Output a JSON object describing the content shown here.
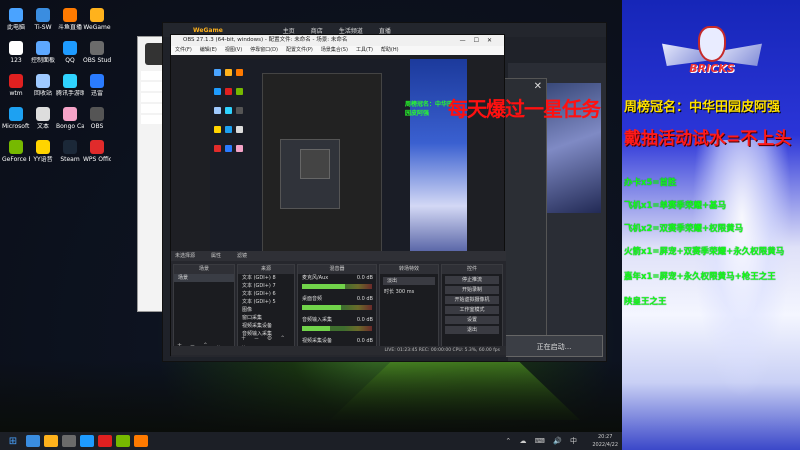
{
  "desktop": {
    "icons": [
      {
        "label": "此电脑",
        "color": "#4aa3ff"
      },
      {
        "label": "Ti-SW",
        "color": "#3a8de0"
      },
      {
        "label": "斗鱼直播",
        "color": "#ff7a00"
      },
      {
        "label": "WeGame",
        "color": "#ffb21c"
      },
      {
        "label": "123",
        "color": "#ffffff"
      },
      {
        "label": "控制面板",
        "color": "#5da8ff"
      },
      {
        "label": "QQ",
        "color": "#1e9bff"
      },
      {
        "label": "OBS Studio",
        "color": "#6b6b6b"
      },
      {
        "label": "wtm",
        "color": "#e02020"
      },
      {
        "label": "回收站",
        "color": "#9ec9ff"
      },
      {
        "label": "腾讯手游助手",
        "color": "#2fd3ff"
      },
      {
        "label": "迅雷",
        "color": "#2a7bff"
      },
      {
        "label": "Microsoft Edge",
        "color": "#1da1f2"
      },
      {
        "label": "文本",
        "color": "#dddddd"
      },
      {
        "label": "Bongo Cat",
        "color": "#f5a3c7"
      },
      {
        "label": "OBS",
        "color": "#555555"
      },
      {
        "label": "GeForce Experience",
        "color": "#76b900"
      },
      {
        "label": "YY语音",
        "color": "#ffd400"
      },
      {
        "label": "Steam",
        "color": "#1b2838"
      },
      {
        "label": "WPS Office",
        "color": "#e02b2b"
      }
    ]
  },
  "taskbar": {
    "start": "⊞",
    "items": [
      "#3a8de0",
      "#ffb21c",
      "#6b6b6b",
      "#1e9bff",
      "#e02020",
      "#76b900",
      "#ff7a00"
    ],
    "tray_icons": "⌃ ☁ ⌨ 🔊 中",
    "time": "20:27",
    "date": "2022/4/22"
  },
  "wegame": {
    "logo": "WeGame",
    "tabs": [
      "主页",
      "商店",
      "生活频道",
      "直播"
    ]
  },
  "obs": {
    "title": "OBS 27.1.3 (64-bit, windows) - 配置文件: 未命名 - 场景: 未命名",
    "menu": [
      "文件(F)",
      "编辑(E)",
      "视图(V)",
      "停靠窗口(D)",
      "配置文件(P)",
      "场景集合(S)",
      "工具(T)",
      "帮助(H)"
    ],
    "dock_tabs": [
      "未选择源",
      "属性",
      "滤镜"
    ],
    "scenes": {
      "header": "场景",
      "items": [
        "场景"
      ]
    },
    "sources": {
      "header": "来源",
      "items": [
        "文本 (GDI+) 8",
        "文本 (GDI+) 7",
        "文本 (GDI+) 6",
        "文本 (GDI+) 5",
        "图像",
        "窗口采集",
        "视频采集设备",
        "音频输入采集"
      ]
    },
    "mixer": {
      "header": "混音器",
      "channels": [
        {
          "name": "麦克风/Aux",
          "db": "0.0 dB",
          "level": 0.62
        },
        {
          "name": "桌面音频",
          "db": "0.0 dB",
          "level": 0.55
        },
        {
          "name": "音频输入采集",
          "db": "0.0 dB",
          "level": 0.4
        },
        {
          "name": "视频采集设备",
          "db": "0.0 dB",
          "level": 0.3
        }
      ]
    },
    "transitions": {
      "header": "转场特效",
      "type": "淡出",
      "duration_label": "时长",
      "duration": "300 ms"
    },
    "controls": {
      "header": "控件",
      "buttons": [
        "停止推流",
        "开始录制",
        "开始虚拟摄像机",
        "工作室模式",
        "设置",
        "退出"
      ]
    },
    "status": "LIVE: 01:23:45   REC: 00:00:00   CPU: 5.3%, 60.00 fps"
  },
  "start_button": "正在启动...",
  "overlay_text": "每天爆过一星任务",
  "panel": {
    "logo_text": "BRICKS",
    "line1": "周榜冠名：中华田园皮阿强",
    "line2": "戴抽活动试水=不上头",
    "lines": [
      "办卡x5=首胜",
      "飞机x1=单赛季荣耀+基马",
      "飞机x2=双赛季荣耀+权限黄马",
      "火箭x1=屏宠+双赛季荣耀+永久权限黄马",
      "嘉年x1=屏宠+永久权限黄马+枪王之王",
      "陕皇王之王"
    ]
  }
}
